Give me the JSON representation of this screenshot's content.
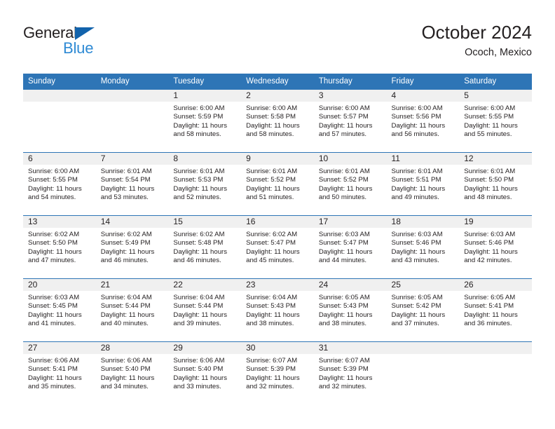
{
  "brand": {
    "name_dark": "General",
    "name_blue": "Blue",
    "triangle_color": "#1263ac",
    "blue_color": "#2e8ad4"
  },
  "header": {
    "title": "October 2024",
    "subtitle": "Ococh, Mexico"
  },
  "theme": {
    "header_blue": "#2e75b6",
    "band_gray": "#f0f0f0",
    "text": "#231f20"
  },
  "weekday_headers": [
    "Sunday",
    "Monday",
    "Tuesday",
    "Wednesday",
    "Thursday",
    "Friday",
    "Saturday"
  ],
  "labels": {
    "sunrise_prefix": "Sunrise:",
    "sunset_prefix": "Sunset:",
    "daylight_prefix": "Daylight:"
  },
  "weeks": [
    [
      {
        "day": "",
        "empty": true
      },
      {
        "day": "",
        "empty": true
      },
      {
        "day": "1",
        "sunrise": "Sunrise: 6:00 AM",
        "sunset": "Sunset: 5:59 PM",
        "daylight_l1": "Daylight: 11 hours",
        "daylight_l2": "and 58 minutes."
      },
      {
        "day": "2",
        "sunrise": "Sunrise: 6:00 AM",
        "sunset": "Sunset: 5:58 PM",
        "daylight_l1": "Daylight: 11 hours",
        "daylight_l2": "and 58 minutes."
      },
      {
        "day": "3",
        "sunrise": "Sunrise: 6:00 AM",
        "sunset": "Sunset: 5:57 PM",
        "daylight_l1": "Daylight: 11 hours",
        "daylight_l2": "and 57 minutes."
      },
      {
        "day": "4",
        "sunrise": "Sunrise: 6:00 AM",
        "sunset": "Sunset: 5:56 PM",
        "daylight_l1": "Daylight: 11 hours",
        "daylight_l2": "and 56 minutes."
      },
      {
        "day": "5",
        "sunrise": "Sunrise: 6:00 AM",
        "sunset": "Sunset: 5:55 PM",
        "daylight_l1": "Daylight: 11 hours",
        "daylight_l2": "and 55 minutes."
      }
    ],
    [
      {
        "day": "6",
        "sunrise": "Sunrise: 6:00 AM",
        "sunset": "Sunset: 5:55 PM",
        "daylight_l1": "Daylight: 11 hours",
        "daylight_l2": "and 54 minutes."
      },
      {
        "day": "7",
        "sunrise": "Sunrise: 6:01 AM",
        "sunset": "Sunset: 5:54 PM",
        "daylight_l1": "Daylight: 11 hours",
        "daylight_l2": "and 53 minutes."
      },
      {
        "day": "8",
        "sunrise": "Sunrise: 6:01 AM",
        "sunset": "Sunset: 5:53 PM",
        "daylight_l1": "Daylight: 11 hours",
        "daylight_l2": "and 52 minutes."
      },
      {
        "day": "9",
        "sunrise": "Sunrise: 6:01 AM",
        "sunset": "Sunset: 5:52 PM",
        "daylight_l1": "Daylight: 11 hours",
        "daylight_l2": "and 51 minutes."
      },
      {
        "day": "10",
        "sunrise": "Sunrise: 6:01 AM",
        "sunset": "Sunset: 5:52 PM",
        "daylight_l1": "Daylight: 11 hours",
        "daylight_l2": "and 50 minutes."
      },
      {
        "day": "11",
        "sunrise": "Sunrise: 6:01 AM",
        "sunset": "Sunset: 5:51 PM",
        "daylight_l1": "Daylight: 11 hours",
        "daylight_l2": "and 49 minutes."
      },
      {
        "day": "12",
        "sunrise": "Sunrise: 6:01 AM",
        "sunset": "Sunset: 5:50 PM",
        "daylight_l1": "Daylight: 11 hours",
        "daylight_l2": "and 48 minutes."
      }
    ],
    [
      {
        "day": "13",
        "sunrise": "Sunrise: 6:02 AM",
        "sunset": "Sunset: 5:50 PM",
        "daylight_l1": "Daylight: 11 hours",
        "daylight_l2": "and 47 minutes."
      },
      {
        "day": "14",
        "sunrise": "Sunrise: 6:02 AM",
        "sunset": "Sunset: 5:49 PM",
        "daylight_l1": "Daylight: 11 hours",
        "daylight_l2": "and 46 minutes."
      },
      {
        "day": "15",
        "sunrise": "Sunrise: 6:02 AM",
        "sunset": "Sunset: 5:48 PM",
        "daylight_l1": "Daylight: 11 hours",
        "daylight_l2": "and 46 minutes."
      },
      {
        "day": "16",
        "sunrise": "Sunrise: 6:02 AM",
        "sunset": "Sunset: 5:47 PM",
        "daylight_l1": "Daylight: 11 hours",
        "daylight_l2": "and 45 minutes."
      },
      {
        "day": "17",
        "sunrise": "Sunrise: 6:03 AM",
        "sunset": "Sunset: 5:47 PM",
        "daylight_l1": "Daylight: 11 hours",
        "daylight_l2": "and 44 minutes."
      },
      {
        "day": "18",
        "sunrise": "Sunrise: 6:03 AM",
        "sunset": "Sunset: 5:46 PM",
        "daylight_l1": "Daylight: 11 hours",
        "daylight_l2": "and 43 minutes."
      },
      {
        "day": "19",
        "sunrise": "Sunrise: 6:03 AM",
        "sunset": "Sunset: 5:46 PM",
        "daylight_l1": "Daylight: 11 hours",
        "daylight_l2": "and 42 minutes."
      }
    ],
    [
      {
        "day": "20",
        "sunrise": "Sunrise: 6:03 AM",
        "sunset": "Sunset: 5:45 PM",
        "daylight_l1": "Daylight: 11 hours",
        "daylight_l2": "and 41 minutes."
      },
      {
        "day": "21",
        "sunrise": "Sunrise: 6:04 AM",
        "sunset": "Sunset: 5:44 PM",
        "daylight_l1": "Daylight: 11 hours",
        "daylight_l2": "and 40 minutes."
      },
      {
        "day": "22",
        "sunrise": "Sunrise: 6:04 AM",
        "sunset": "Sunset: 5:44 PM",
        "daylight_l1": "Daylight: 11 hours",
        "daylight_l2": "and 39 minutes."
      },
      {
        "day": "23",
        "sunrise": "Sunrise: 6:04 AM",
        "sunset": "Sunset: 5:43 PM",
        "daylight_l1": "Daylight: 11 hours",
        "daylight_l2": "and 38 minutes."
      },
      {
        "day": "24",
        "sunrise": "Sunrise: 6:05 AM",
        "sunset": "Sunset: 5:43 PM",
        "daylight_l1": "Daylight: 11 hours",
        "daylight_l2": "and 38 minutes."
      },
      {
        "day": "25",
        "sunrise": "Sunrise: 6:05 AM",
        "sunset": "Sunset: 5:42 PM",
        "daylight_l1": "Daylight: 11 hours",
        "daylight_l2": "and 37 minutes."
      },
      {
        "day": "26",
        "sunrise": "Sunrise: 6:05 AM",
        "sunset": "Sunset: 5:41 PM",
        "daylight_l1": "Daylight: 11 hours",
        "daylight_l2": "and 36 minutes."
      }
    ],
    [
      {
        "day": "27",
        "sunrise": "Sunrise: 6:06 AM",
        "sunset": "Sunset: 5:41 PM",
        "daylight_l1": "Daylight: 11 hours",
        "daylight_l2": "and 35 minutes."
      },
      {
        "day": "28",
        "sunrise": "Sunrise: 6:06 AM",
        "sunset": "Sunset: 5:40 PM",
        "daylight_l1": "Daylight: 11 hours",
        "daylight_l2": "and 34 minutes."
      },
      {
        "day": "29",
        "sunrise": "Sunrise: 6:06 AM",
        "sunset": "Sunset: 5:40 PM",
        "daylight_l1": "Daylight: 11 hours",
        "daylight_l2": "and 33 minutes."
      },
      {
        "day": "30",
        "sunrise": "Sunrise: 6:07 AM",
        "sunset": "Sunset: 5:39 PM",
        "daylight_l1": "Daylight: 11 hours",
        "daylight_l2": "and 32 minutes."
      },
      {
        "day": "31",
        "sunrise": "Sunrise: 6:07 AM",
        "sunset": "Sunset: 5:39 PM",
        "daylight_l1": "Daylight: 11 hours",
        "daylight_l2": "and 32 minutes."
      },
      {
        "day": "",
        "empty": true
      },
      {
        "day": "",
        "empty": true
      }
    ]
  ]
}
